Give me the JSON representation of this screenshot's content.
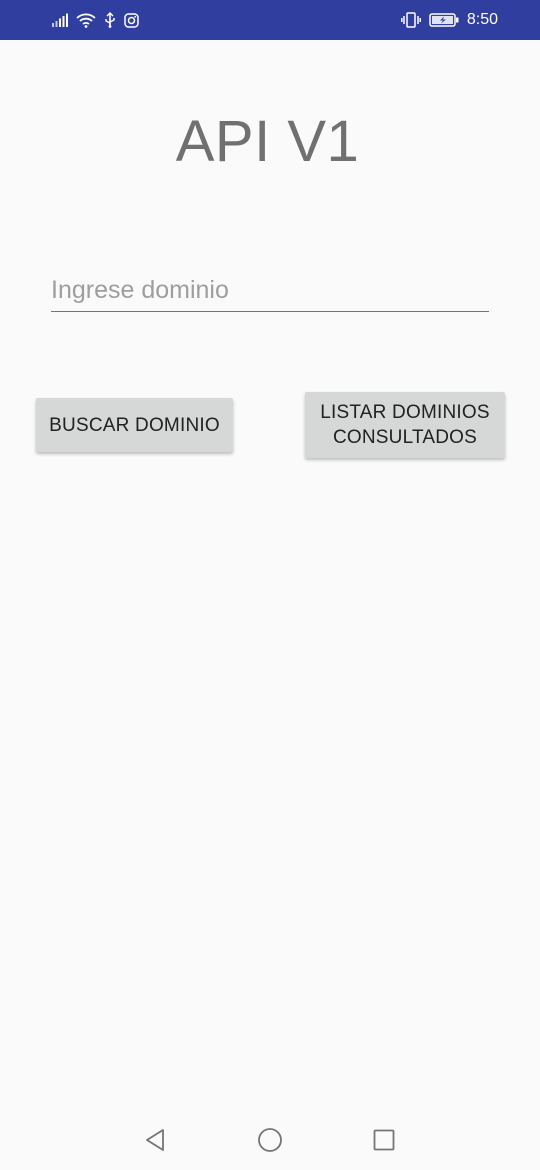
{
  "status_bar": {
    "time": "8:50",
    "background_color": "#303f9f",
    "left_icons": [
      "signal-icon",
      "wifi-icon",
      "usb-icon",
      "instagram-icon"
    ],
    "right_icons": [
      "vibrate-icon",
      "battery-charging-icon"
    ]
  },
  "main": {
    "title": "API V1",
    "domain_input": {
      "placeholder": "Ingrese dominio",
      "value": ""
    },
    "buttons": {
      "search_label": "BUSCAR DOMINIO",
      "list_label_line1": "LISTAR DOMINIOS",
      "list_label_line2": "CONSULTADOS"
    }
  },
  "nav_bar": {
    "icons": [
      "back-icon",
      "home-icon",
      "recent-apps-icon"
    ]
  }
}
